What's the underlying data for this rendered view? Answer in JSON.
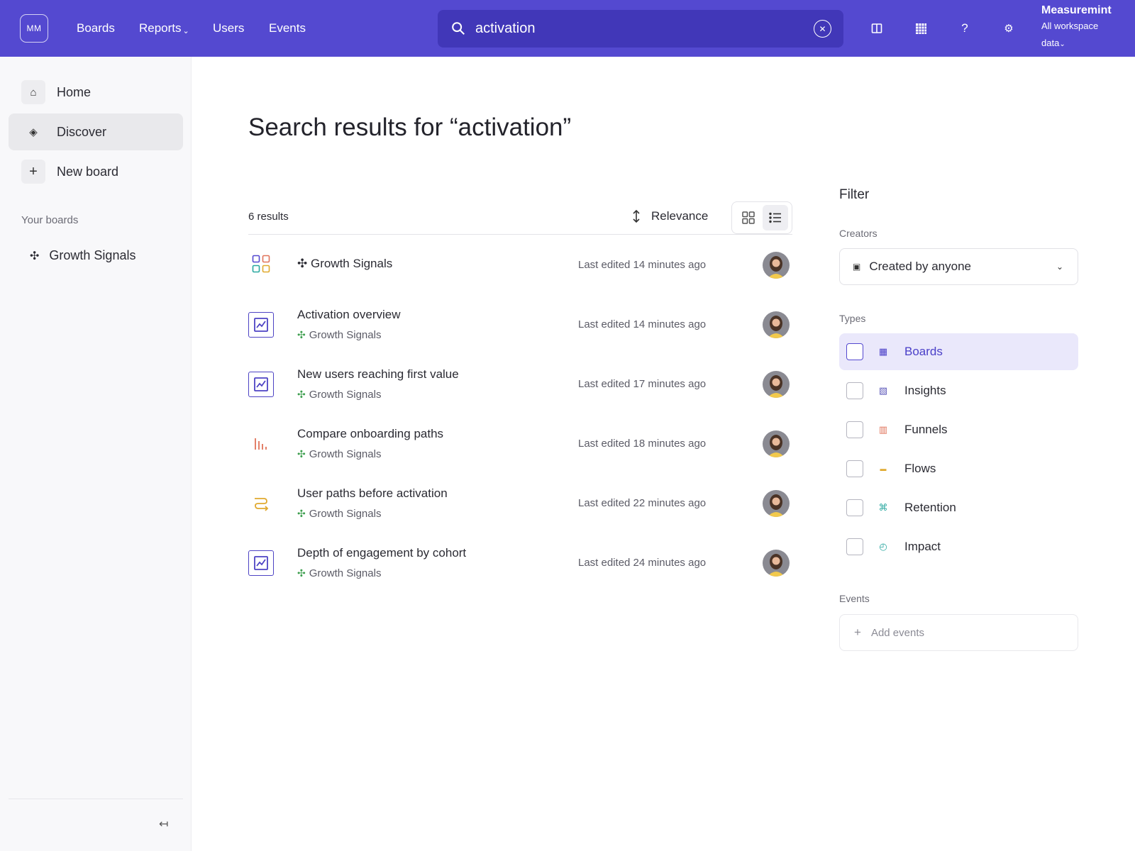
{
  "topbar": {
    "logo": "MM",
    "nav": [
      {
        "label": "Boards"
      },
      {
        "label": "Reports",
        "caret": "⌄"
      },
      {
        "label": "Users"
      },
      {
        "label": "Events"
      }
    ],
    "search_value": "activation",
    "account_name": "Measuremint",
    "workspace": "All workspace data",
    "workspace_caret": "⌄",
    "icons": [
      "layout-icon",
      "calendar-grid-icon",
      "help-icon",
      "settings-icon"
    ]
  },
  "sidebar": {
    "items": [
      {
        "label": "Home",
        "icon": "⌂"
      },
      {
        "label": "Discover",
        "icon": "◈"
      },
      {
        "label": "New board",
        "icon": "+"
      }
    ],
    "section_label": "Your boards",
    "boards": [
      {
        "label": "Growth Signals",
        "icon": "✣"
      }
    ],
    "collapse_icon": "↤"
  },
  "main": {
    "title": "Search results for “activation”",
    "results_count": "6 results",
    "sort_label": "Relevance",
    "results": [
      {
        "title": "✣ Growth Signals",
        "subtitle": "",
        "edited": "Last edited 14 minutes ago",
        "type": "board"
      },
      {
        "title": "Activation overview",
        "subtitle": "Growth Signals",
        "edited": "Last edited 14 minutes ago",
        "type": "insight"
      },
      {
        "title": "New users reaching first value",
        "subtitle": "Growth Signals",
        "edited": "Last edited 17 minutes ago",
        "type": "insight"
      },
      {
        "title": "Compare onboarding paths",
        "subtitle": "Growth Signals",
        "edited": "Last edited 18 minutes ago",
        "type": "funnel"
      },
      {
        "title": "User paths before activation",
        "subtitle": "Growth Signals",
        "edited": "Last edited 22 minutes ago",
        "type": "flow"
      },
      {
        "title": "Depth of engagement by cohort",
        "subtitle": "Growth Signals",
        "edited": "Last edited 24 minutes ago",
        "type": "insight"
      }
    ]
  },
  "filter": {
    "title": "Filter",
    "creators_label": "Creators",
    "creator_value": "Created by anyone",
    "types_label": "Types",
    "types": [
      {
        "label": "Boards",
        "icon": "▦",
        "color": "#4a3fc8",
        "checked": false
      },
      {
        "label": "Insights",
        "icon": "▧",
        "color": "#5a55b8",
        "checked": false
      },
      {
        "label": "Funnels",
        "icon": "▥",
        "color": "#e0735a",
        "checked": false
      },
      {
        "label": "Flows",
        "icon": "▬",
        "color": "#e0a92e",
        "checked": false
      },
      {
        "label": "Retention",
        "icon": "⌘",
        "color": "#2aa8a0",
        "checked": false
      },
      {
        "label": "Impact",
        "icon": "◴",
        "color": "#2aa8a0",
        "checked": false
      }
    ],
    "events_label": "Events",
    "add_events": "Add events"
  },
  "colors": {
    "brand": "#5449d0",
    "search_bg": "#4137b8",
    "highlight": "#eae8fb",
    "growth_icon": "#3d9e4e"
  }
}
